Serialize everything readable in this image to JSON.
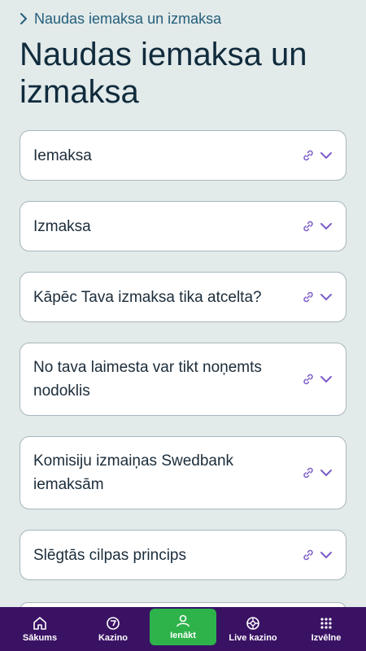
{
  "breadcrumb": {
    "label": "Naudas iemaksa un izmaksa"
  },
  "page": {
    "title": "Naudas iemaksa un izmaksa"
  },
  "accordion": {
    "items": [
      {
        "label": "Iemaksa"
      },
      {
        "label": "Izmaksa"
      },
      {
        "label": "Kāpēc Tava izmaksa tika atcelta?"
      },
      {
        "label": "No tava laimesta var tikt noņemts nodoklis"
      },
      {
        "label": "Komisiju izmaiņas Swedbank iemaksām"
      },
      {
        "label": "Slēgtās cilpas princips"
      }
    ]
  },
  "nav": {
    "items": [
      {
        "label": "Sākums",
        "icon": "home-icon"
      },
      {
        "label": "Kazino",
        "icon": "casino-chip-icon"
      },
      {
        "label": "Ienākt",
        "icon": "user-icon"
      },
      {
        "label": "Live kazino",
        "icon": "roulette-icon"
      },
      {
        "label": "Izvēlne",
        "icon": "grid-menu-icon"
      }
    ]
  },
  "colors": {
    "background": "#e2eaea",
    "accent_purple": "#7a5cc8",
    "nav_background": "#3a1264",
    "login_green": "#2db34a",
    "breadcrumb_link": "#245e7a"
  }
}
